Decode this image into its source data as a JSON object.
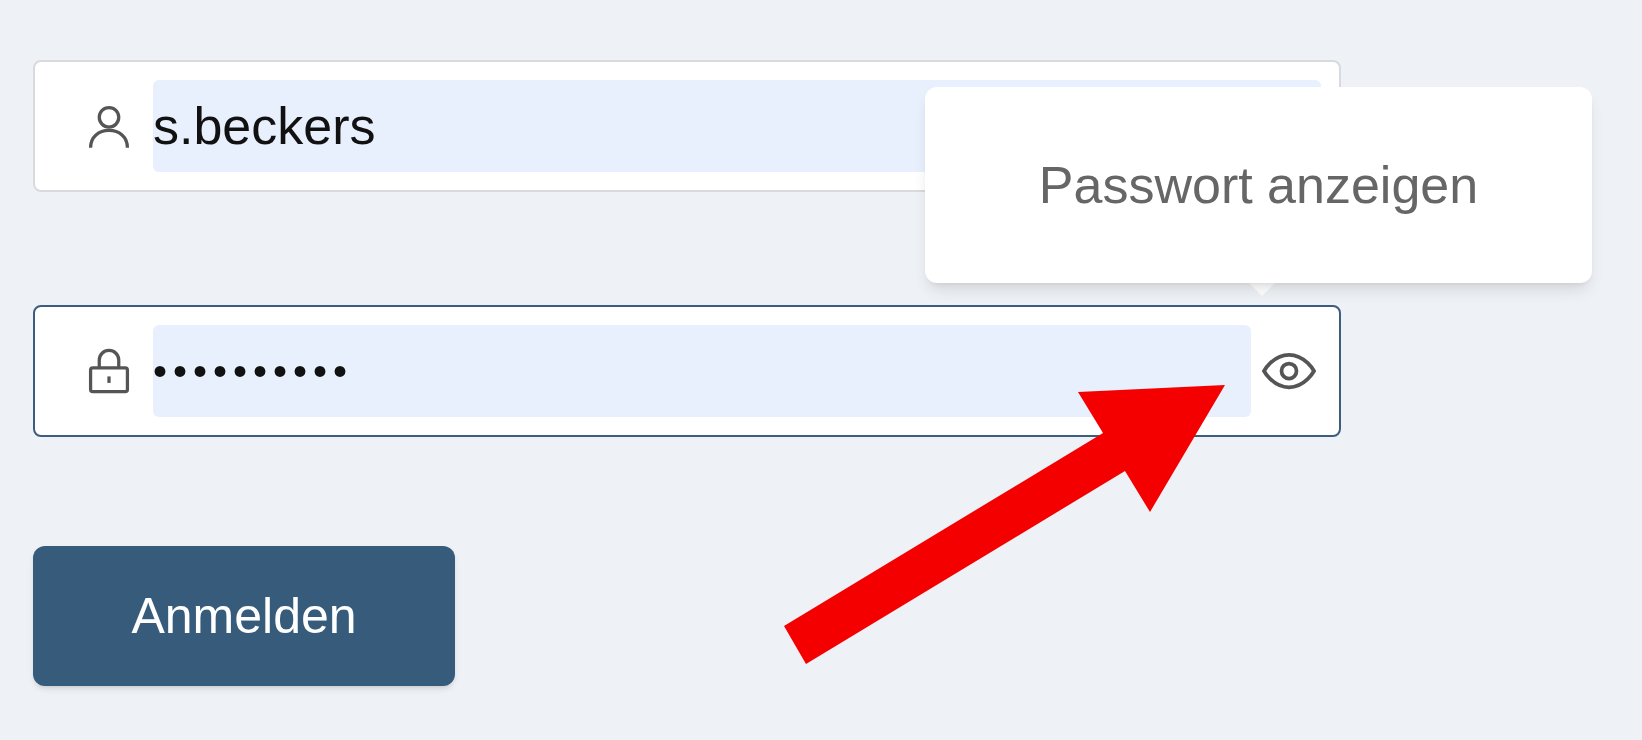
{
  "username": {
    "value": "s.beckers",
    "focused": false
  },
  "password": {
    "value": "••••••••••",
    "focused": true
  },
  "tooltip": {
    "text": "Passwort anzeigen"
  },
  "submit_button": {
    "label": "Anmelden"
  }
}
